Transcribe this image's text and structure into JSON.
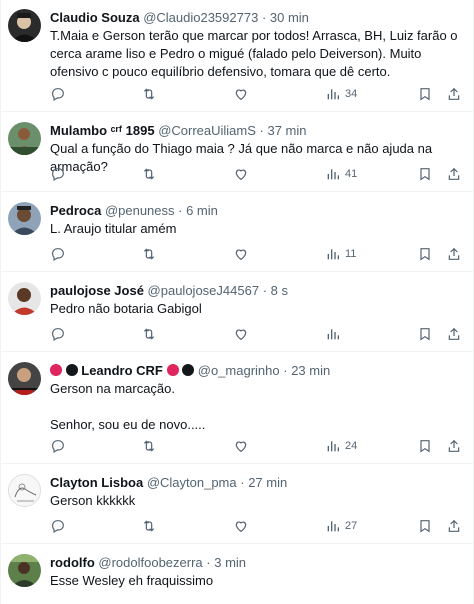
{
  "tweets": [
    {
      "name": "Claudio Souza",
      "handle": "@Claudio23592773",
      "time": "30 min",
      "text": "T.Maia e Gerson terão que marcar por todos! Arrasca, BH, Luiz farão o cerca arame liso e Pedro o migué (falado pelo Deiverson). Muito ofensivo c pouco equilíbrio defensivo, tomara que dê certo.",
      "views": "34",
      "avatar": "avatar-dark-portrait"
    },
    {
      "name": "Mulambo ᶜʳᶠ 1895",
      "handle": "@CorreaUiliamS",
      "time": "37 min",
      "text": "Qual a função do Thiago maia ? Já que não marca e não ajuda na armação?",
      "views": "41",
      "avatar": "avatar-player-photo"
    },
    {
      "name": "Pedroca",
      "handle": "@penuness",
      "time": "6 min",
      "text": "L. Araujo titular amém",
      "views": "11",
      "avatar": "avatar-person-portrait"
    },
    {
      "name": "paulojose José",
      "handle": "@paulojoseJ44567",
      "time": "8 s",
      "text": "Pedro não botaria Gabigol",
      "views": "",
      "avatar": "avatar-person-red-shirt"
    },
    {
      "name_prefix_icons": [
        "red-circle",
        "black-circle"
      ],
      "name": "Leandro CRF",
      "name_suffix_icons": [
        "red-circle",
        "black-circle"
      ],
      "handle": "@o_magrinho",
      "time": "23 min",
      "text": "Gerson na marcação.\n\nSenhor, sou eu de novo.....",
      "views": "24",
      "avatar": "avatar-flamengo-fan"
    },
    {
      "name": "Clayton Lisboa",
      "handle": "@Clayton_pma",
      "time": "27 min",
      "text": "Gerson kkkkkk",
      "views": "27",
      "avatar": "avatar-sketch-drawing"
    },
    {
      "name": "rodolfo",
      "handle": "@rodolfoobezerra",
      "time": "3 min",
      "text": "Esse Wesley eh fraquissimo",
      "views": "",
      "avatar": "avatar-green-outdoor"
    }
  ],
  "colors": {
    "text": "#0f1419",
    "muted": "#536471",
    "divider": "#eff3f4",
    "red": "#e0245e",
    "black": "#14171a"
  },
  "icons": [
    "reply-icon",
    "retweet-icon",
    "like-icon",
    "views-icon",
    "bookmark-icon",
    "share-icon"
  ]
}
